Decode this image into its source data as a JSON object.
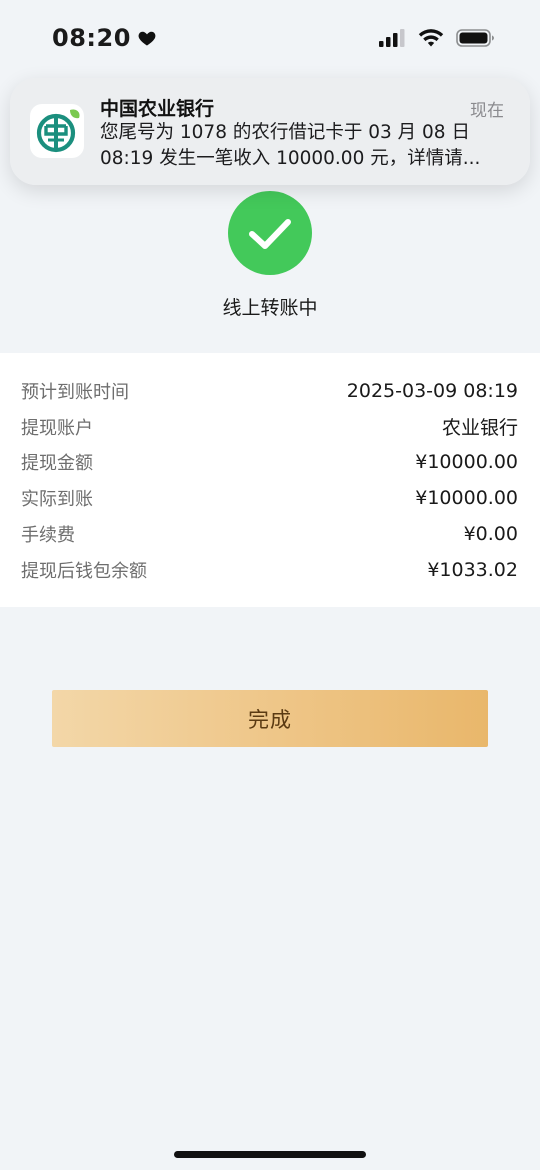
{
  "status_bar": {
    "time": "08:20",
    "icons": [
      "heart-icon",
      "cellular-signal-icon",
      "wifi-icon",
      "battery-icon"
    ]
  },
  "notification": {
    "app_name": "中国农业银行",
    "time": "现在",
    "body_line1": "您尾号为 1078 的农行借记卡于 03 月 08 日",
    "body_line2": "08:19 发生一笔收入 10000.00 元，详情请..."
  },
  "status": {
    "text": "线上转账中",
    "icon": "checkmark-icon",
    "color": "#43c95a"
  },
  "details": {
    "rows": [
      {
        "label": "预计到账时间",
        "value": "2025-03-09 08:19"
      },
      {
        "label": "提现账户",
        "value": "农业银行"
      },
      {
        "label": "提现金额",
        "value": "¥10000.00"
      },
      {
        "label": "实际到账",
        "value": "¥10000.00"
      },
      {
        "label": "手续费",
        "value": "¥0.00"
      },
      {
        "label": "提现后钱包余额",
        "value": "¥1033.02"
      }
    ]
  },
  "actions": {
    "done_label": "完成"
  },
  "colors": {
    "background": "#f1f4f7",
    "button_gradient_start": "#f3d7a8",
    "button_gradient_end": "#e9b76b",
    "button_text": "#5a3a12"
  }
}
